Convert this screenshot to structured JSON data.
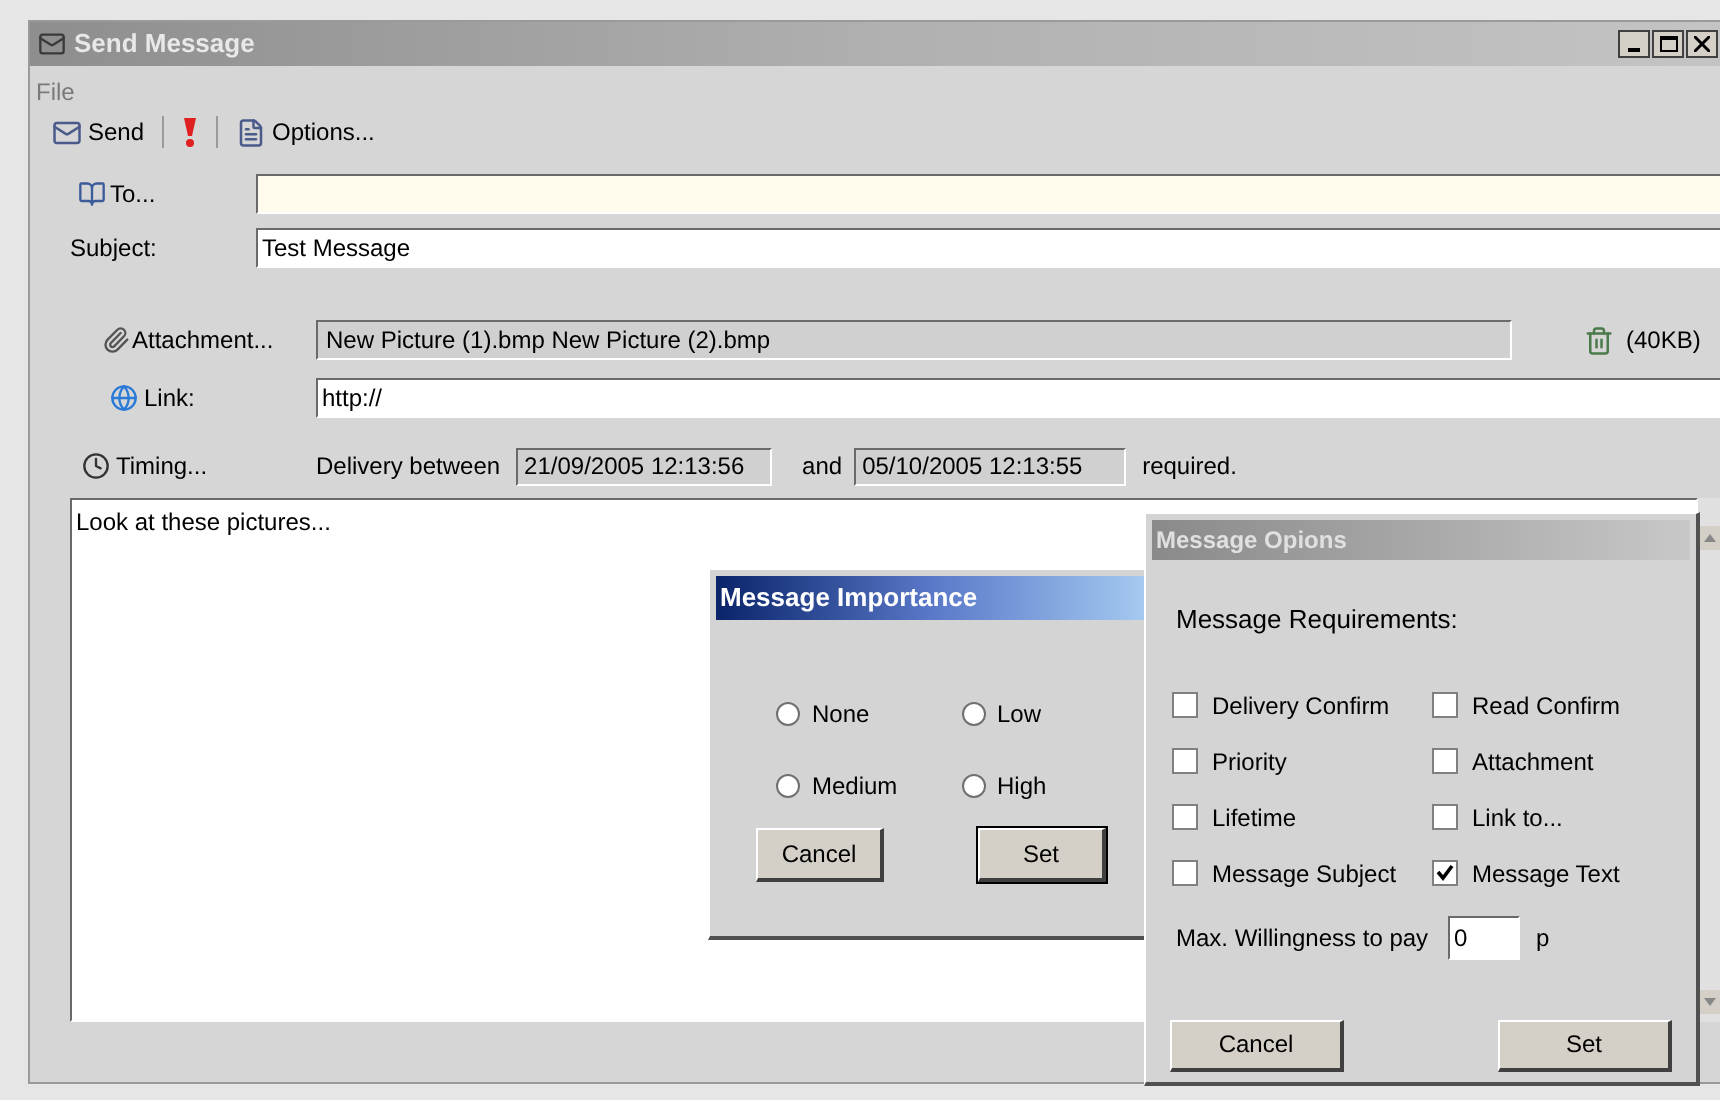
{
  "window": {
    "title": "Send Message"
  },
  "menu": [
    "File"
  ],
  "toolbar": [
    {
      "kind": "send",
      "label": "Send"
    },
    {
      "kind": "importance"
    },
    {
      "kind": "options",
      "label": "Options..."
    }
  ],
  "to": {
    "label": "To..."
  },
  "subject": {
    "label": "Subject:",
    "value": "Test Message"
  },
  "attachment": {
    "label": "Attachment...",
    "value": "New Picture (1).bmp New Picture (2).bmp",
    "size": "(40KB)"
  },
  "link": {
    "label": "Link:",
    "value": "http://"
  },
  "timing": {
    "label": "Timing...",
    "prefix": "Delivery between",
    "from": "21/09/2005 12:13:56",
    "conjunction": "and",
    "to": "05/10/2005 12:13:55",
    "suffix": "required."
  },
  "body": "Look at these pictures...",
  "importance_dialog": {
    "title": "Message Importance",
    "options": [
      {
        "label": "None",
        "selected": false
      },
      {
        "label": "Low",
        "selected": false
      },
      {
        "label": "Medium",
        "selected": false
      },
      {
        "label": "High",
        "selected": false
      }
    ],
    "buttons": [
      {
        "label": "Cancel",
        "default": false
      },
      {
        "label": "Set",
        "default": true
      }
    ]
  },
  "options_dialog": {
    "title": "Message Opions",
    "heading": "Message Requirements:",
    "requirements": [
      {
        "label": "Delivery Confirm",
        "checked": false
      },
      {
        "label": "Read Confirm",
        "checked": false
      },
      {
        "label": "Priority",
        "checked": false
      },
      {
        "label": "Attachment",
        "checked": false
      },
      {
        "label": "Lifetime",
        "checked": false
      },
      {
        "label": "Link to...",
        "checked": false
      },
      {
        "label": "Message Subject",
        "checked": false
      },
      {
        "label": "Message Text",
        "checked": true
      }
    ],
    "willingness": {
      "label": "Max. Willingness to pay",
      "value": "0",
      "unit": "p"
    },
    "buttons": [
      {
        "label": "Cancel",
        "default": false
      },
      {
        "label": "Set",
        "default": false
      }
    ]
  }
}
